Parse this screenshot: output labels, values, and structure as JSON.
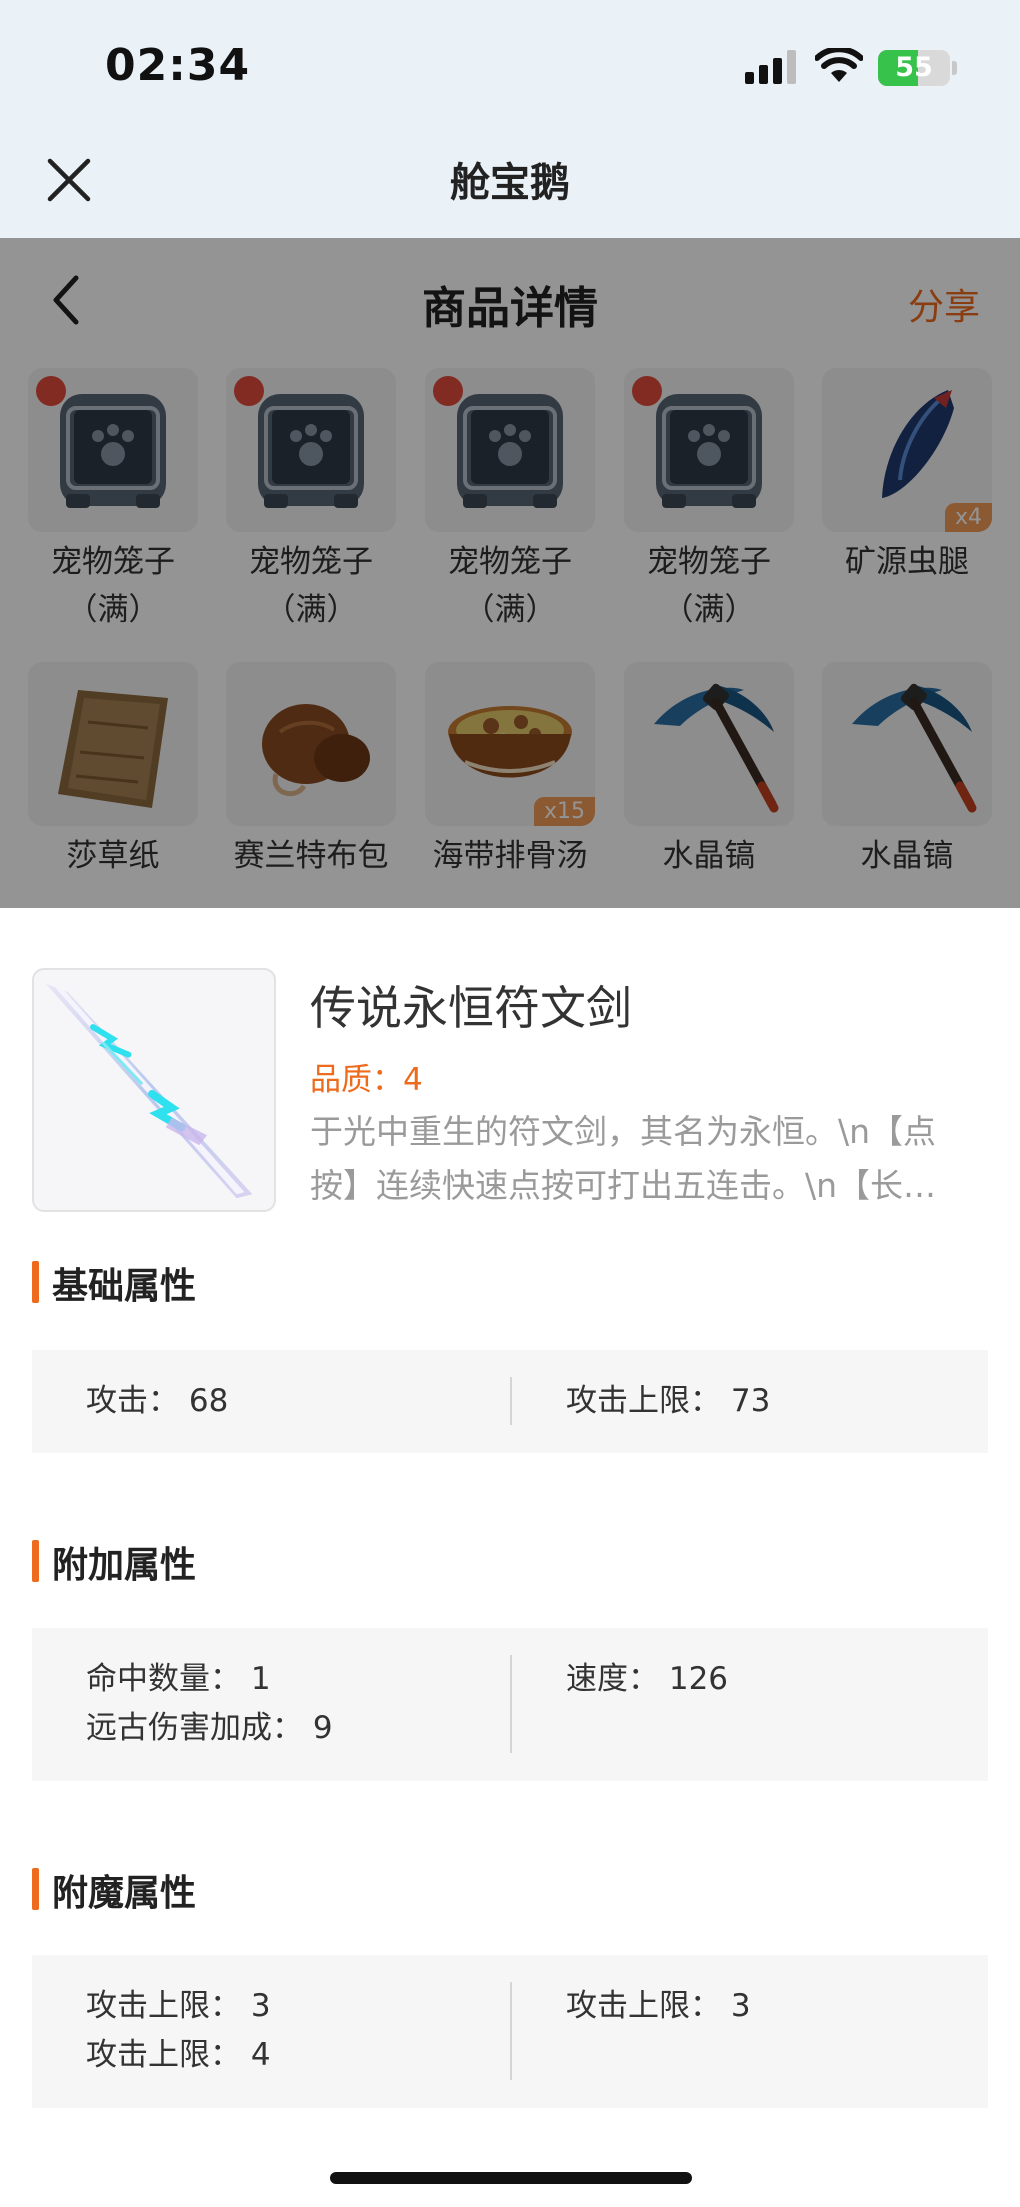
{
  "status_bar": {
    "time": "02:34",
    "battery": "55",
    "battery_level": 0.55
  },
  "header": {
    "title": "舱宝鹅"
  },
  "page": {
    "title": "商品详情",
    "share_label": "分享"
  },
  "grid_items": [
    {
      "name": "宠物笼子",
      "sub": "（满）",
      "icon": "pet-cage-icon",
      "qty": ""
    },
    {
      "name": "宠物笼子",
      "sub": "（满）",
      "icon": "pet-cage-icon",
      "qty": ""
    },
    {
      "name": "宠物笼子",
      "sub": "（满）",
      "icon": "pet-cage-icon",
      "qty": ""
    },
    {
      "name": "宠物笼子",
      "sub": "（满）",
      "icon": "pet-cage-icon",
      "qty": ""
    },
    {
      "name": "矿源虫腿",
      "sub": "",
      "icon": "insect-leg-icon",
      "qty": "x4"
    },
    {
      "name": "莎草纸",
      "sub": "",
      "icon": "papyrus-icon",
      "qty": ""
    },
    {
      "name": "赛兰特布包",
      "sub": "",
      "icon": "cloth-bag-icon",
      "qty": ""
    },
    {
      "name": "海带排骨汤",
      "sub": "",
      "icon": "soup-bowl-icon",
      "qty": "x15"
    },
    {
      "name": "水晶镐",
      "sub": "",
      "icon": "pickaxe-icon",
      "qty": ""
    },
    {
      "name": "水晶镐",
      "sub": "",
      "icon": "pickaxe-icon",
      "qty": ""
    }
  ],
  "item": {
    "title": "传说永恒符文剑",
    "quality": "品质：4",
    "desc_line1": "于光中重生的符文剑，其名为永恒。\\n【点",
    "desc_line2": "按】连续快速点按可打出五连击。\\n【长…",
    "icon": "rune-sword-icon"
  },
  "sections": {
    "basic": {
      "title": "基础属性",
      "left": [
        "攻击： 68"
      ],
      "right": [
        "攻击上限： 73"
      ]
    },
    "extra": {
      "title": "附加属性",
      "left": [
        "命中数量： 1",
        "远古伤害加成： 9"
      ],
      "right": [
        "速度： 126"
      ]
    },
    "enchant": {
      "title": "附魔属性",
      "left": [
        "攻击上限： 3",
        "攻击上限： 4"
      ],
      "right": [
        "攻击上限： 3"
      ]
    }
  },
  "colors": {
    "accent": "#ee6a1d",
    "header_bg": "#eaf2f7",
    "battery": "#37c24c"
  }
}
